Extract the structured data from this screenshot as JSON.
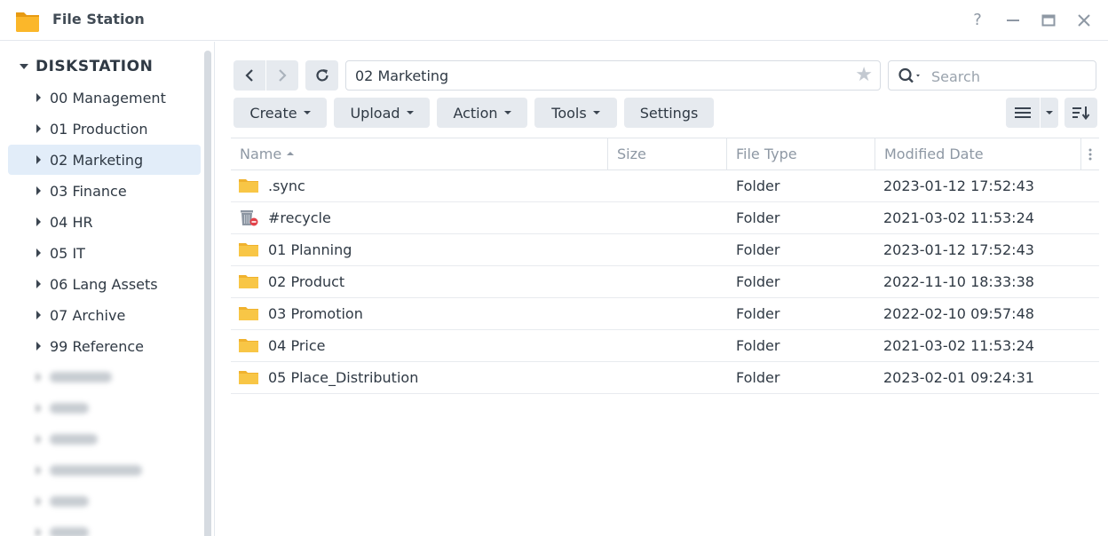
{
  "window": {
    "title": "File Station",
    "controls": {
      "help": "?",
      "minimize": "—",
      "maximize": "☐",
      "close": "✕"
    }
  },
  "sidebar": {
    "root": "DISKSTATION",
    "items": [
      {
        "label": "00 Management"
      },
      {
        "label": "01 Production"
      },
      {
        "label": "02 Marketing",
        "active": true
      },
      {
        "label": "03 Finance"
      },
      {
        "label": "04 HR"
      },
      {
        "label": "05 IT"
      },
      {
        "label": "06 Lang Assets"
      },
      {
        "label": "07 Archive"
      },
      {
        "label": "99 Reference"
      }
    ]
  },
  "toolbar": {
    "path": "02 Marketing",
    "search_placeholder": "Search",
    "buttons": {
      "create": "Create",
      "upload": "Upload",
      "action": "Action",
      "tools": "Tools",
      "settings": "Settings"
    }
  },
  "table": {
    "columns": {
      "name": "Name",
      "size": "Size",
      "type": "File Type",
      "modified": "Modified Date"
    },
    "rows": [
      {
        "name": ".sync",
        "size": "",
        "type": "Folder",
        "modified": "2023-01-12 17:52:43",
        "icon": "folder-icon"
      },
      {
        "name": "#recycle",
        "size": "",
        "type": "Folder",
        "modified": "2021-03-02 11:53:24",
        "icon": "recycle-bin-icon"
      },
      {
        "name": "01 Planning",
        "size": "",
        "type": "Folder",
        "modified": "2023-01-12 17:52:43",
        "icon": "folder-icon"
      },
      {
        "name": "02 Product",
        "size": "",
        "type": "Folder",
        "modified": "2022-11-10 18:33:38",
        "icon": "folder-icon"
      },
      {
        "name": "03 Promotion",
        "size": "",
        "type": "Folder",
        "modified": "2022-02-10 09:57:48",
        "icon": "folder-icon"
      },
      {
        "name": "04 Price",
        "size": "",
        "type": "Folder",
        "modified": "2021-03-02 11:53:24",
        "icon": "folder-icon"
      },
      {
        "name": "05 Place_Distribution",
        "size": "",
        "type": "Folder",
        "modified": "2023-02-01 09:24:31",
        "icon": "folder-icon"
      }
    ]
  },
  "colors": {
    "accent_selection": "#e2edf9",
    "button_bg": "#e6eaef",
    "folder_yellow": "#f8c646"
  }
}
